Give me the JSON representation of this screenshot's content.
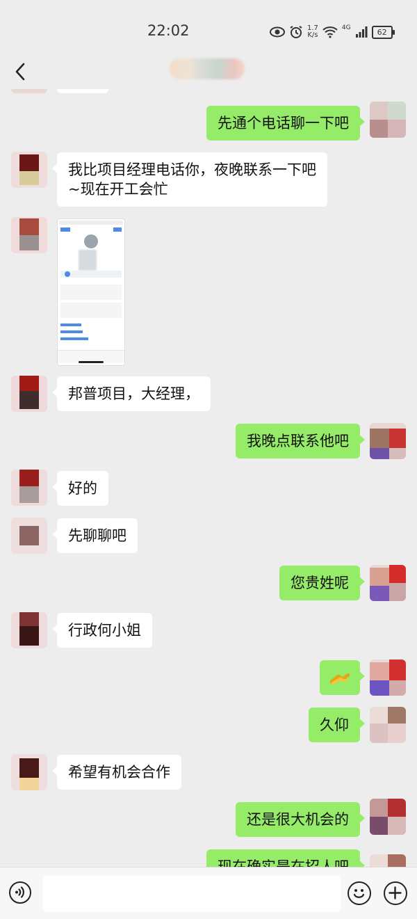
{
  "status_bar": {
    "time": "22:02",
    "net_speed_value": "1.7",
    "net_speed_unit": "K/s",
    "network": "4G",
    "battery": "62"
  },
  "nav": {
    "back_icon": "chevron-left-icon",
    "more_icon": "more-dots-icon"
  },
  "messages": [
    {
      "side": "out",
      "text": "先通个电话聊一下吧"
    },
    {
      "side": "in",
      "text": "我比项目经理电话你，夜晚联系一下吧\n~现在开工会忙"
    },
    {
      "side": "in",
      "type": "image"
    },
    {
      "side": "in",
      "text": "邦普项目，大经理，"
    },
    {
      "side": "out",
      "text": "我晚点联系他吧"
    },
    {
      "side": "in",
      "text": "好的"
    },
    {
      "side": "in",
      "text": "先聊聊吧"
    },
    {
      "side": "out",
      "text": "您贵姓呢"
    },
    {
      "side": "in",
      "text": "行政何小姐"
    },
    {
      "side": "out",
      "type": "emoji",
      "emoji": "handshake"
    },
    {
      "side": "out",
      "text": "久仰"
    },
    {
      "side": "in",
      "text": "希望有机会合作"
    },
    {
      "side": "out",
      "text": "还是很大机会的"
    },
    {
      "side": "out",
      "text": "现在确实是在招人吧"
    }
  ],
  "input_bar": {
    "voice_icon": "voice-icon",
    "emoji_icon": "emoji-icon",
    "plus_icon": "plus-icon"
  },
  "colors": {
    "out_bubble": "#95ec69",
    "in_bubble": "#ffffff",
    "background": "#ededed"
  }
}
